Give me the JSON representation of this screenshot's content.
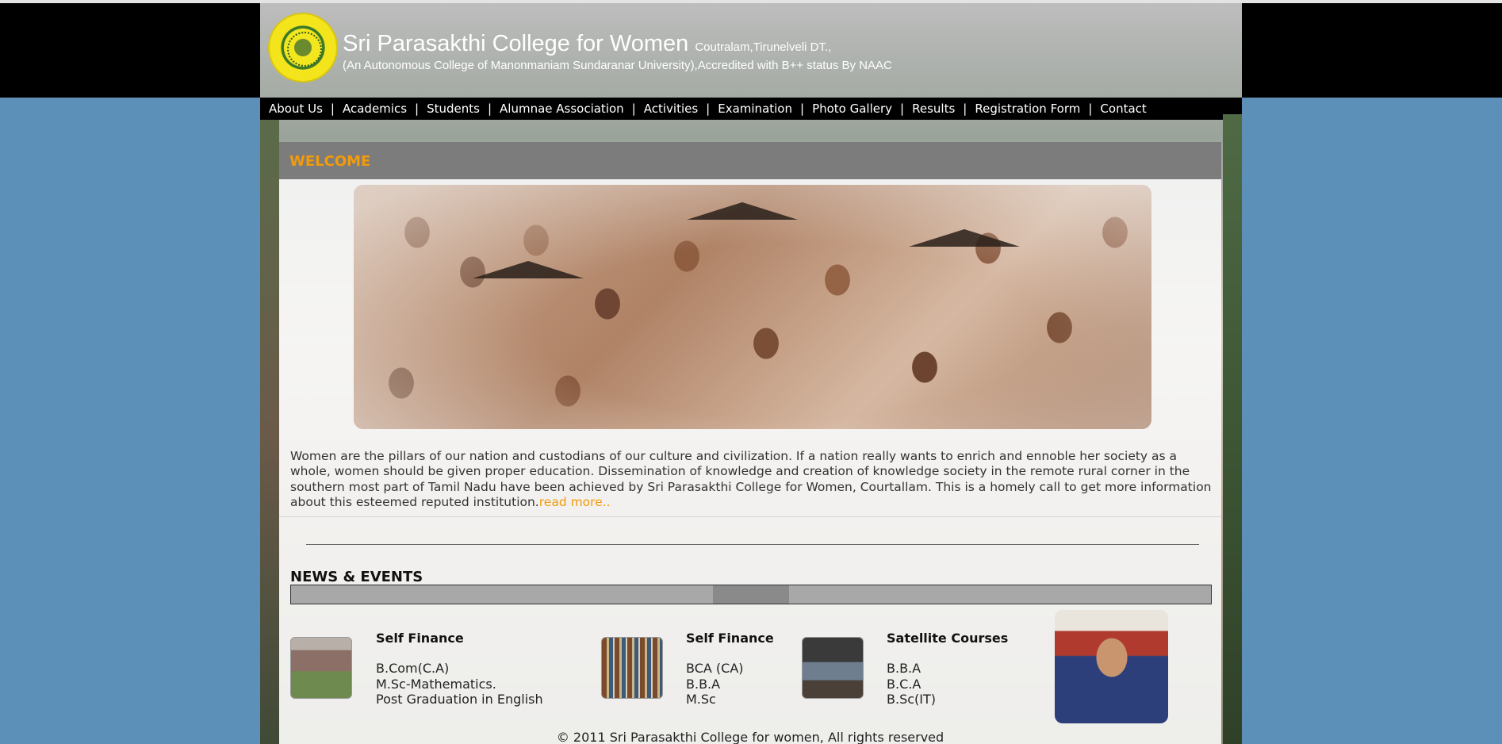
{
  "header": {
    "college_name": "Sri Parasakthi College for Women",
    "location": "Coutralam,Tirunelveli DT.,",
    "subtitle": "(An Autonomous College of Manonmaniam Sundaranar University),Accredited with B++ status By NAAC"
  },
  "nav": {
    "items": [
      "About Us",
      "Academics",
      "Students",
      "Alumnae Association",
      "Activities",
      "Examination",
      "Photo Gallery",
      "Results",
      "Registration Form",
      "Contact"
    ],
    "separator": "|"
  },
  "welcome": {
    "title": "WELCOME",
    "intro": "Women are the pillars of our nation and custodians of our culture and civilization. If a nation really wants to enrich and ennoble her society as a whole, women should be given proper education. Dissemination of knowledge and creation of knowledge society in the remote rural corner in the southern most part of Tamil Nadu have been achieved by Sri Parasakthi College for Women, Courtallam. This is a homely call to get more information about this esteemed reputed institution.",
    "read_more": "read more.."
  },
  "news": {
    "title": "NEWS & EVENTS"
  },
  "courses": [
    {
      "title": "Self Finance",
      "lines": [
        "B.Com(C.A)",
        "M.Sc-Mathematics.",
        "Post Graduation in English"
      ],
      "icon": "college-building-photo"
    },
    {
      "title": "Self Finance",
      "lines": [
        "BCA (CA)",
        "B.B.A",
        "M.Sc"
      ],
      "icon": "library-books-photo"
    },
    {
      "title": "Satellite Courses",
      "lines": [
        "B.B.A",
        "B.C.A",
        "B.Sc(IT)"
      ],
      "icon": "computer-lab-photo"
    }
  ],
  "footer": {
    "text": "© 2011 Sri Parasakthi College for women, All rights reserved"
  },
  "colors": {
    "background": "#5d90b8",
    "header": "#000000",
    "accent": "#f29b0b",
    "welcome_bar": "#7c7c7c"
  }
}
